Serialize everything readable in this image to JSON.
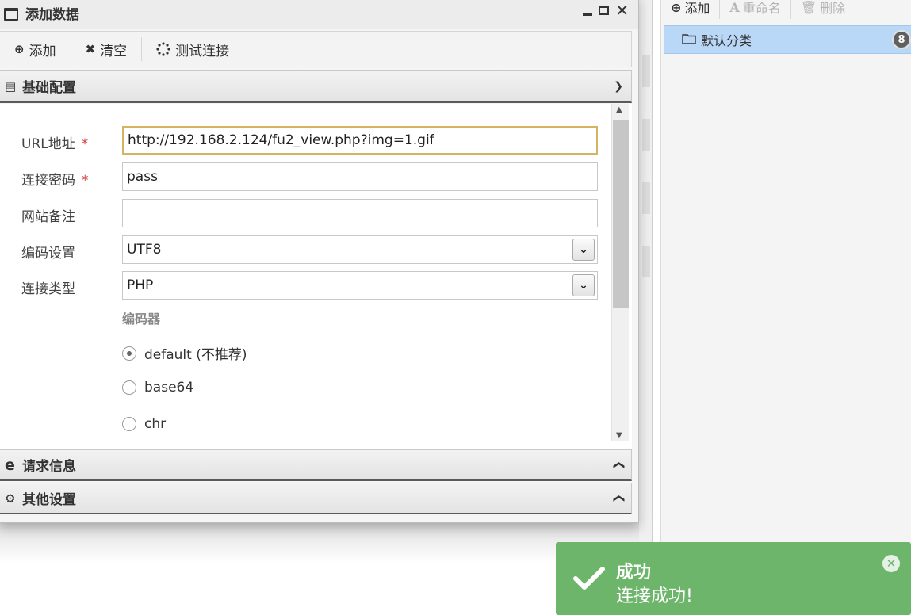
{
  "dialog": {
    "title": "添加数据",
    "toolbar": {
      "add_label": "添加",
      "clear_label": "清空",
      "test_label": "测试连接"
    },
    "sections": {
      "basic": "基础配置",
      "request": "请求信息",
      "other": "其他设置"
    },
    "form": {
      "url_label": "URL地址",
      "url_value": "http://192.168.2.124/fu2_view.php?img=1.gif",
      "password_label": "连接密码",
      "password_value": "pass",
      "note_label": "网站备注",
      "note_value": "",
      "encoding_label": "编码设置",
      "encoding_value": "UTF8",
      "type_label": "连接类型",
      "type_value": "PHP",
      "required_mark": "*",
      "encoder_title": "编码器",
      "encoders": [
        "default (不推荐)",
        "base64",
        "chr"
      ],
      "selected_encoder": "default (不推荐)"
    }
  },
  "right_panel": {
    "toolbar": {
      "add_label": "添加",
      "rename_label": "重命名",
      "delete_label": "删除"
    },
    "category": {
      "label": "默认分类",
      "count": "8"
    }
  },
  "toast": {
    "title": "成功",
    "message": "连接成功!",
    "color": "#6eb56c"
  }
}
